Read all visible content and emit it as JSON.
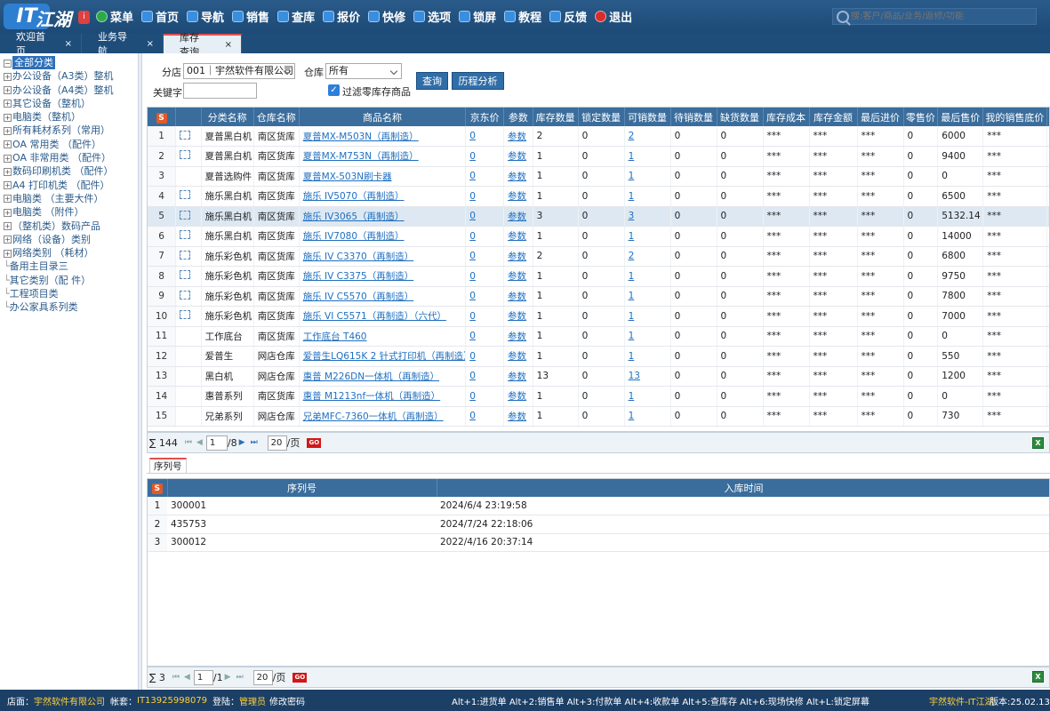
{
  "app": {
    "logo_text": "IT江湖",
    "logo_badge": "i"
  },
  "menu": [
    {
      "label": "菜单",
      "icon": "menu-icon"
    },
    {
      "label": "首页",
      "icon": "home-icon"
    },
    {
      "label": "导航",
      "icon": "grid-icon"
    },
    {
      "label": "销售",
      "icon": "sales-icon"
    },
    {
      "label": "查库",
      "icon": "warehouse-icon"
    },
    {
      "label": "报价",
      "icon": "quote-icon"
    },
    {
      "label": "快修",
      "icon": "repair-icon"
    },
    {
      "label": "选项",
      "icon": "options-icon"
    },
    {
      "label": "锁屏",
      "icon": "lock-icon"
    },
    {
      "label": "教程",
      "icon": "tutorial-icon"
    },
    {
      "label": "反馈",
      "icon": "feedback-icon"
    },
    {
      "label": "退出",
      "icon": "exit-icon"
    }
  ],
  "search": {
    "placeholder": "搜:客户/商品/业务/返修/功能"
  },
  "tabs": [
    {
      "label": "欢迎首页",
      "close": "×"
    },
    {
      "label": "业务导航",
      "close": "×"
    },
    {
      "label": "库存查询",
      "close": "×"
    }
  ],
  "tree": {
    "root": "全部分类",
    "items": [
      "办公设备（A3类）整机",
      "办公设备（A4类）整机",
      "其它设备（整机）",
      "电脑类（整机）",
      "所有耗材系列（常用）",
      "OA 常用类 （配件）",
      "OA 非常用类 （配件）",
      "数码印刷机类 （配件）",
      "A4 打印机类 （配件）",
      "电脑类 （主要大件）",
      "电脑类 （附件）",
      "（整机类）数码产品",
      "网络（设备）类别",
      "网络类别 （耗材）"
    ],
    "leaves": [
      "备用主目录三",
      "其它类别（配 件）",
      "工程项目类",
      "办公家具系列类"
    ]
  },
  "filter": {
    "branch_label": "分店",
    "branch_value": "001｜宇然软件有限公司",
    "warehouse_label": "仓库",
    "warehouse_value": "所有",
    "keyword_label": "关键字",
    "keyword_value": "",
    "checkbox_label": "过滤零库存商品",
    "query_button": "查询",
    "history_button": "历程分析"
  },
  "grid": {
    "columns": [
      "分类名称",
      "仓库名称",
      "商品名称",
      "京东价",
      "参数",
      "库存数量",
      "锁定数量",
      "可销数量",
      "待销数量",
      "缺货数量",
      "库存成本",
      "库存金额",
      "最后进价",
      "零售价",
      "最后售价",
      "我的销售底价",
      "网"
    ],
    "rows": [
      {
        "n": "1",
        "cat": "夏普黑白机",
        "wh": "南区货库",
        "name": "夏普MX-M503N（再制造）",
        "jd": "0",
        "param": "参数",
        "stock": "2",
        "lock": "0",
        "avail": "2",
        "pend": "0",
        "short": "0",
        "cost": "***",
        "amt": "***",
        "lastin": "***",
        "retail": "0",
        "lastsale": "6000",
        "floor": "***",
        "net": "0"
      },
      {
        "n": "2",
        "cat": "夏普黑白机",
        "wh": "南区货库",
        "name": "夏普MX-M753N（再制造）",
        "jd": "0",
        "param": "参数",
        "stock": "1",
        "lock": "0",
        "avail": "1",
        "pend": "0",
        "short": "0",
        "cost": "***",
        "amt": "***",
        "lastin": "***",
        "retail": "0",
        "lastsale": "9400",
        "floor": "***",
        "net": "0"
      },
      {
        "n": "3",
        "cat": "夏普选购件",
        "wh": "南区货库",
        "name": "夏普MX-503N刷卡器",
        "jd": "0",
        "param": "参数",
        "stock": "1",
        "lock": "0",
        "avail": "1",
        "pend": "0",
        "short": "0",
        "cost": "***",
        "amt": "***",
        "lastin": "***",
        "retail": "0",
        "lastsale": "0",
        "floor": "***",
        "net": "0"
      },
      {
        "n": "4",
        "cat": "施乐黑白机",
        "wh": "南区货库",
        "name": "施乐 IV5070（再制造）",
        "jd": "0",
        "param": "参数",
        "stock": "1",
        "lock": "0",
        "avail": "1",
        "pend": "0",
        "short": "0",
        "cost": "***",
        "amt": "***",
        "lastin": "***",
        "retail": "0",
        "lastsale": "6500",
        "floor": "***",
        "net": "0"
      },
      {
        "n": "5",
        "cat": "施乐黑白机",
        "wh": "南区货库",
        "name": "施乐 IV3065（再制造）",
        "jd": "0",
        "param": "参数",
        "stock": "3",
        "lock": "0",
        "avail": "3",
        "pend": "0",
        "short": "0",
        "cost": "***",
        "amt": "***",
        "lastin": "***",
        "retail": "0",
        "lastsale": "5132.14",
        "floor": "***",
        "net": "0"
      },
      {
        "n": "6",
        "cat": "施乐黑白机",
        "wh": "南区货库",
        "name": "施乐 IV7080（再制造）",
        "jd": "0",
        "param": "参数",
        "stock": "1",
        "lock": "0",
        "avail": "1",
        "pend": "0",
        "short": "0",
        "cost": "***",
        "amt": "***",
        "lastin": "***",
        "retail": "0",
        "lastsale": "14000",
        "floor": "***",
        "net": "0"
      },
      {
        "n": "7",
        "cat": "施乐彩色机",
        "wh": "南区货库",
        "name": "施乐 IV C3370（再制造）",
        "jd": "0",
        "param": "参数",
        "stock": "2",
        "lock": "0",
        "avail": "2",
        "pend": "0",
        "short": "0",
        "cost": "***",
        "amt": "***",
        "lastin": "***",
        "retail": "0",
        "lastsale": "6800",
        "floor": "***",
        "net": "0"
      },
      {
        "n": "8",
        "cat": "施乐彩色机",
        "wh": "南区货库",
        "name": "施乐 IV C3375（再制造）",
        "jd": "0",
        "param": "参数",
        "stock": "1",
        "lock": "0",
        "avail": "1",
        "pend": "0",
        "short": "0",
        "cost": "***",
        "amt": "***",
        "lastin": "***",
        "retail": "0",
        "lastsale": "9750",
        "floor": "***",
        "net": "0"
      },
      {
        "n": "9",
        "cat": "施乐彩色机",
        "wh": "南区货库",
        "name": "施乐 IV C5570（再制造）",
        "jd": "0",
        "param": "参数",
        "stock": "1",
        "lock": "0",
        "avail": "1",
        "pend": "0",
        "short": "0",
        "cost": "***",
        "amt": "***",
        "lastin": "***",
        "retail": "0",
        "lastsale": "7800",
        "floor": "***",
        "net": "0"
      },
      {
        "n": "10",
        "cat": "施乐彩色机",
        "wh": "南区货库",
        "name": "施乐 VI C5571（再制造）（六代）",
        "jd": "0",
        "param": "参数",
        "stock": "1",
        "lock": "0",
        "avail": "1",
        "pend": "0",
        "short": "0",
        "cost": "***",
        "amt": "***",
        "lastin": "***",
        "retail": "0",
        "lastsale": "7000",
        "floor": "***",
        "net": "0"
      },
      {
        "n": "11",
        "cat": "工作底台",
        "wh": "南区货库",
        "name": "工作底台 T460",
        "jd": "0",
        "param": "参数",
        "stock": "1",
        "lock": "0",
        "avail": "1",
        "pend": "0",
        "short": "0",
        "cost": "***",
        "amt": "***",
        "lastin": "***",
        "retail": "0",
        "lastsale": "0",
        "floor": "***",
        "net": "0"
      },
      {
        "n": "12",
        "cat": "爱普生",
        "wh": "网店仓库",
        "name": "爱普生LQ615K 2 针式打印机（再制造）",
        "jd": "0",
        "param": "参数",
        "stock": "1",
        "lock": "0",
        "avail": "1",
        "pend": "0",
        "short": "0",
        "cost": "***",
        "amt": "***",
        "lastin": "***",
        "retail": "0",
        "lastsale": "550",
        "floor": "***",
        "net": "0"
      },
      {
        "n": "13",
        "cat": "黑白机",
        "wh": "网店仓库",
        "name": "惠普 M226DN一体机（再制造）",
        "jd": "0",
        "param": "参数",
        "stock": "13",
        "lock": "0",
        "avail": "13",
        "pend": "0",
        "short": "0",
        "cost": "***",
        "amt": "***",
        "lastin": "***",
        "retail": "0",
        "lastsale": "1200",
        "floor": "***",
        "net": "0"
      },
      {
        "n": "14",
        "cat": "惠普系列",
        "wh": "南区货库",
        "name": "惠普 M1213nf一体机（再制造）",
        "jd": "0",
        "param": "参数",
        "stock": "1",
        "lock": "0",
        "avail": "1",
        "pend": "0",
        "short": "0",
        "cost": "***",
        "amt": "***",
        "lastin": "***",
        "retail": "0",
        "lastsale": "0",
        "floor": "***",
        "net": "0"
      },
      {
        "n": "15",
        "cat": "兄弟系列",
        "wh": "网店仓库",
        "name": "兄弟MFC-7360一体机（再制造）",
        "jd": "0",
        "param": "参数",
        "stock": "1",
        "lock": "0",
        "avail": "1",
        "pend": "0",
        "short": "0",
        "cost": "***",
        "amt": "***",
        "lastin": "***",
        "retail": "0",
        "lastsale": "730",
        "floor": "***",
        "net": "0"
      }
    ]
  },
  "pager": {
    "total": "∑ 144",
    "page": "1",
    "pages": "/8",
    "size": "20",
    "size_unit": "/页",
    "go": "GO"
  },
  "subtab": {
    "label": "序列号"
  },
  "serial": {
    "columns": [
      "序列号",
      "入库时间"
    ],
    "rows": [
      {
        "n": "1",
        "sn": "300001",
        "time": "2024/6/4 23:19:58"
      },
      {
        "n": "2",
        "sn": "435753",
        "time": "2024/7/24 22:18:06"
      },
      {
        "n": "3",
        "sn": "300012",
        "time": "2022/4/16 20:37:14"
      }
    ]
  },
  "pager2": {
    "total": "∑ 3",
    "page": "1",
    "pages": "/1",
    "size": "20",
    "size_unit": "/页",
    "go": "GO"
  },
  "status": {
    "shop_label": "店面：",
    "shop": "宇然软件有限公司",
    "account_label": "帐套：",
    "account": "IT13925998079",
    "login_label": "登陆：",
    "login": "管理员",
    "change_pw": "修改密码",
    "shortcuts": "Alt+1:进货单  Alt+2:销售单  Alt+3:付款单  Alt+4:收款单  Alt+5:查库存  Alt+6:现场快修  Alt+L:锁定屏幕",
    "brand": "宇然软件-IT江湖",
    "version": "版本:25.02.13"
  }
}
